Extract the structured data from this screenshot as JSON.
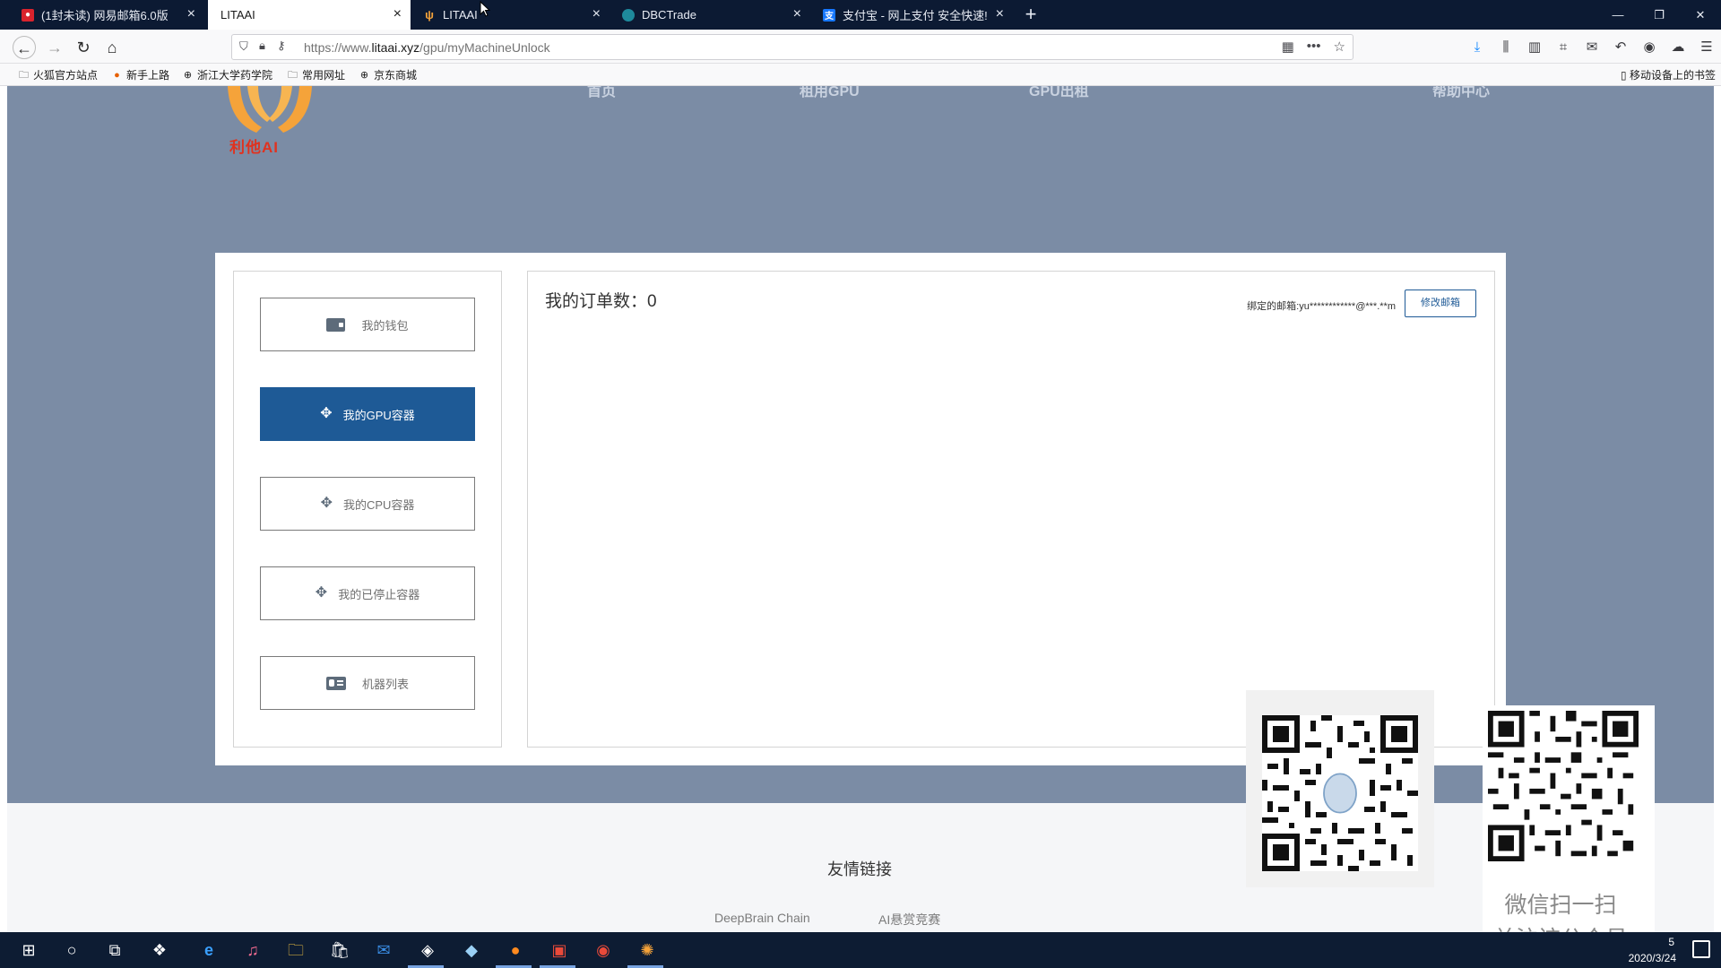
{
  "browser": {
    "tabs": [
      {
        "title": "(1封未读) 网易邮箱6.0版",
        "icon": "netease-mail-icon"
      },
      {
        "title": "LITAAI",
        "icon": "blank-page-icon",
        "active": true
      },
      {
        "title": "LITAAI",
        "icon": "litaai-logo-icon"
      },
      {
        "title": "DBCTrade",
        "icon": "dbc-icon"
      },
      {
        "title": "支付宝 - 网上支付 安全快速!",
        "icon": "alipay-icon"
      }
    ],
    "window_controls": [
      "—",
      "❐",
      "✕"
    ],
    "url": {
      "prefix": "https://www.",
      "domain": "litaai.xyz",
      "path": "/gpu/myMachineUnlock"
    },
    "bookmarks": [
      {
        "label": "火狐官方站点",
        "icon": "folder-icon"
      },
      {
        "label": "新手上路",
        "icon": "firefox-icon"
      },
      {
        "label": "浙江大学药学院",
        "icon": "globe-icon"
      },
      {
        "label": "常用网址",
        "icon": "folder-icon"
      },
      {
        "label": "京东商城",
        "icon": "globe-icon"
      }
    ],
    "bookmarks_right": "移动设备上的书签"
  },
  "site": {
    "logo_text": "利他AI",
    "nav": [
      "首页",
      "租用GPU",
      "GPU出租",
      "帮助中心"
    ],
    "sidebar": [
      {
        "label": "我的钱包",
        "icon": "wallet-icon",
        "active": false
      },
      {
        "label": "我的GPU容器",
        "icon": "gpu-container-icon",
        "active": true
      },
      {
        "label": "我的CPU容器",
        "icon": "cpu-container-icon",
        "active": false
      },
      {
        "label": "我的已停止容器",
        "icon": "stopped-container-icon",
        "active": false
      },
      {
        "label": "机器列表",
        "icon": "machine-list-icon",
        "active": false
      }
    ],
    "main": {
      "order_count_label": "我的订单数：",
      "order_count": "0",
      "bound_email_label": "绑定的邮箱:yu************@***.**m",
      "change_email_button": "修改邮箱"
    },
    "footer": {
      "title": "友情链接",
      "links": [
        "DeepBrain Chain",
        "AI悬赏竞赛"
      ]
    },
    "wechat_qr_caption": [
      "微信扫一扫",
      "关注该公众号"
    ]
  },
  "taskbar": {
    "time": "5",
    "date": "2020/3/24"
  },
  "colors": {
    "hero_bg": "#7b8ca5",
    "accent": "#1e5a96",
    "tabbar_bg": "#0c1a33",
    "logo_red": "#e0321f",
    "logo_orange": "#f5a33a"
  }
}
